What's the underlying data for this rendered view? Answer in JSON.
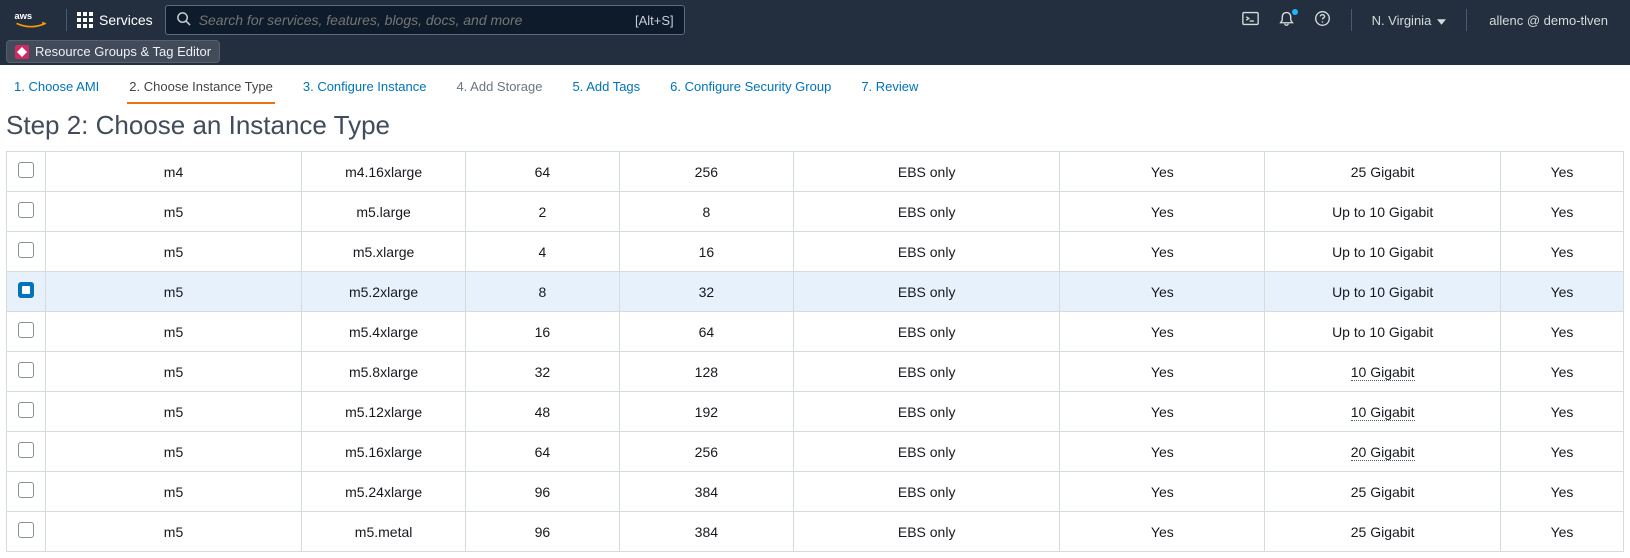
{
  "header": {
    "services_label": "Services",
    "search_placeholder": "Search for services, features, blogs, docs, and more",
    "search_shortcut": "[Alt+S]",
    "region_label": "N. Virginia",
    "user_label": "allenc @ demo-tlven"
  },
  "sub_nav": {
    "resource_groups_label": "Resource Groups & Tag Editor"
  },
  "wizard_steps": [
    {
      "label": "1. Choose AMI",
      "state": "link"
    },
    {
      "label": "2. Choose Instance Type",
      "state": "active"
    },
    {
      "label": "3. Configure Instance",
      "state": "link"
    },
    {
      "label": "4. Add Storage",
      "state": "disabled"
    },
    {
      "label": "5. Add Tags",
      "state": "link"
    },
    {
      "label": "6. Configure Security Group",
      "state": "link"
    },
    {
      "label": "7. Review",
      "state": "link"
    }
  ],
  "page_title": "Step 2: Choose an Instance Type",
  "rows": [
    {
      "checked": false,
      "family": "m4",
      "type": "m4.16xlarge",
      "vcpu": "64",
      "mem": "256",
      "storage": "EBS only",
      "ebs_opt": "Yes",
      "net": "25 Gigabit",
      "net_dotted": false,
      "ipv6": "Yes"
    },
    {
      "checked": false,
      "family": "m5",
      "type": "m5.large",
      "vcpu": "2",
      "mem": "8",
      "storage": "EBS only",
      "ebs_opt": "Yes",
      "net": "Up to 10 Gigabit",
      "net_dotted": false,
      "ipv6": "Yes"
    },
    {
      "checked": false,
      "family": "m5",
      "type": "m5.xlarge",
      "vcpu": "4",
      "mem": "16",
      "storage": "EBS only",
      "ebs_opt": "Yes",
      "net": "Up to 10 Gigabit",
      "net_dotted": false,
      "ipv6": "Yes"
    },
    {
      "checked": true,
      "family": "m5",
      "type": "m5.2xlarge",
      "vcpu": "8",
      "mem": "32",
      "storage": "EBS only",
      "ebs_opt": "Yes",
      "net": "Up to 10 Gigabit",
      "net_dotted": false,
      "ipv6": "Yes"
    },
    {
      "checked": false,
      "family": "m5",
      "type": "m5.4xlarge",
      "vcpu": "16",
      "mem": "64",
      "storage": "EBS only",
      "ebs_opt": "Yes",
      "net": "Up to 10 Gigabit",
      "net_dotted": false,
      "ipv6": "Yes"
    },
    {
      "checked": false,
      "family": "m5",
      "type": "m5.8xlarge",
      "vcpu": "32",
      "mem": "128",
      "storage": "EBS only",
      "ebs_opt": "Yes",
      "net": "10 Gigabit",
      "net_dotted": true,
      "ipv6": "Yes"
    },
    {
      "checked": false,
      "family": "m5",
      "type": "m5.12xlarge",
      "vcpu": "48",
      "mem": "192",
      "storage": "EBS only",
      "ebs_opt": "Yes",
      "net": "10 Gigabit",
      "net_dotted": true,
      "ipv6": "Yes"
    },
    {
      "checked": false,
      "family": "m5",
      "type": "m5.16xlarge",
      "vcpu": "64",
      "mem": "256",
      "storage": "EBS only",
      "ebs_opt": "Yes",
      "net": "20 Gigabit",
      "net_dotted": true,
      "ipv6": "Yes"
    },
    {
      "checked": false,
      "family": "m5",
      "type": "m5.24xlarge",
      "vcpu": "96",
      "mem": "384",
      "storage": "EBS only",
      "ebs_opt": "Yes",
      "net": "25 Gigabit",
      "net_dotted": false,
      "ipv6": "Yes"
    },
    {
      "checked": false,
      "family": "m5",
      "type": "m5.metal",
      "vcpu": "96",
      "mem": "384",
      "storage": "EBS only",
      "ebs_opt": "Yes",
      "net": "25 Gigabit",
      "net_dotted": false,
      "ipv6": "Yes"
    }
  ]
}
